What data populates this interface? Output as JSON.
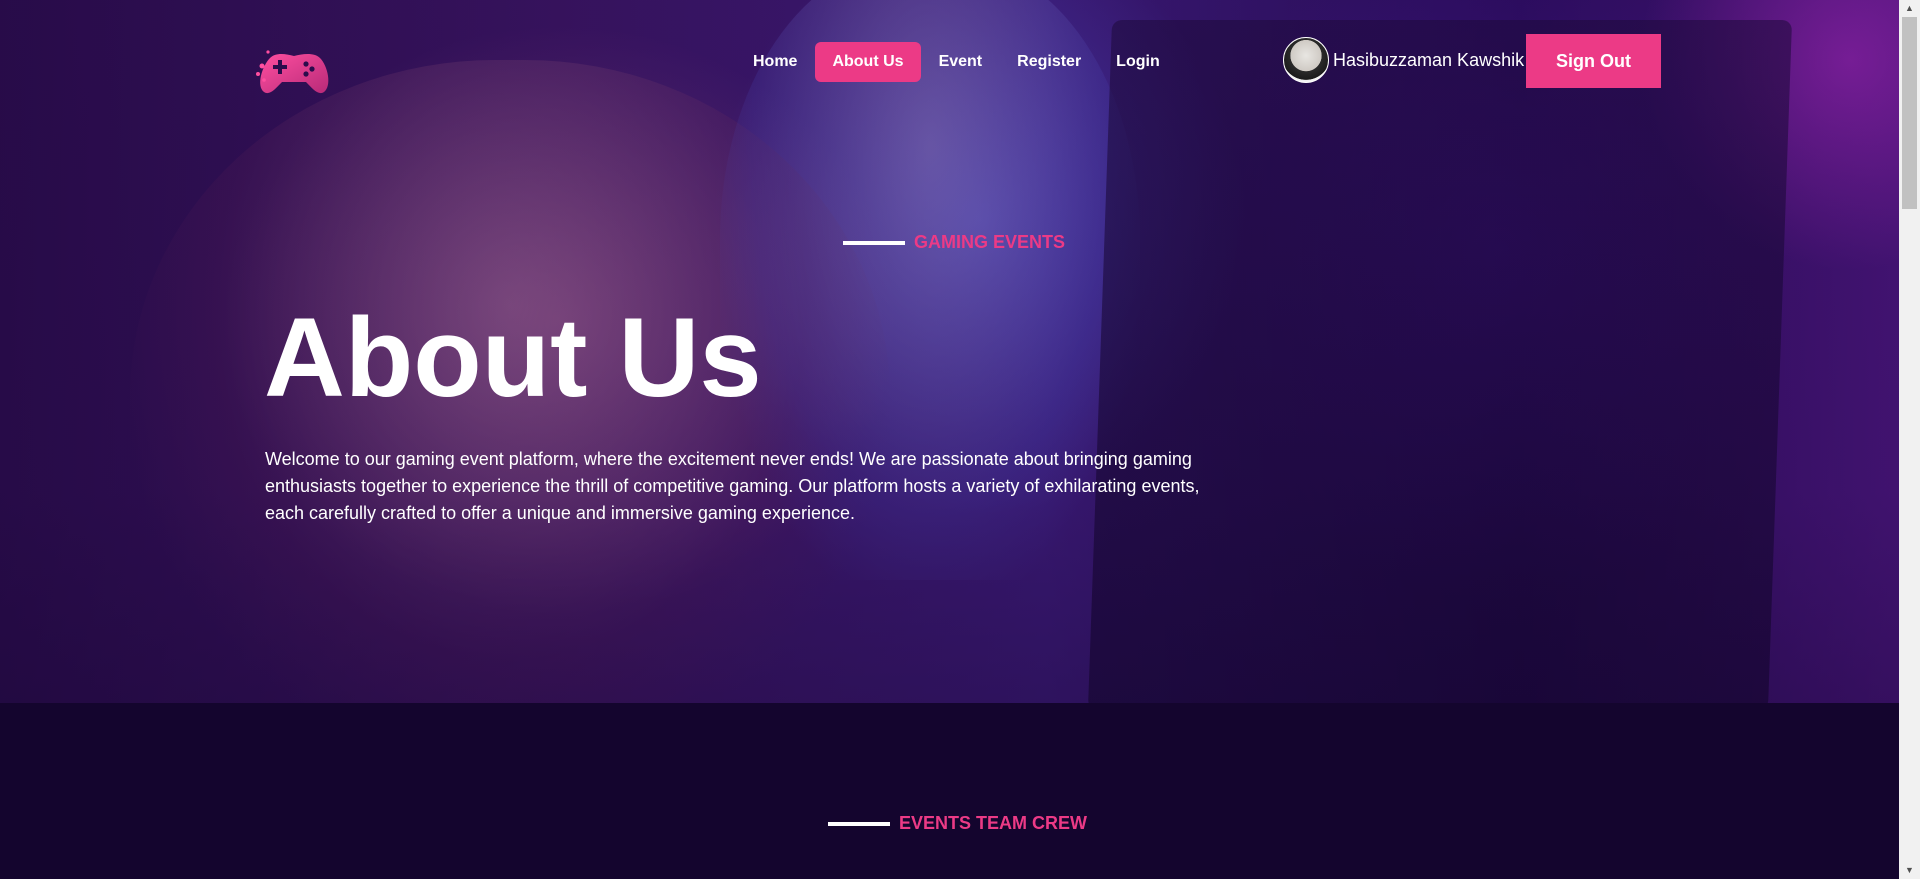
{
  "header": {
    "logo_icon": "gamepad-icon",
    "nav": [
      {
        "label": "Home"
      },
      {
        "label": "About Us",
        "active": true
      },
      {
        "label": "Event"
      },
      {
        "label": "Register"
      },
      {
        "label": "Login"
      }
    ],
    "user": {
      "name": "Hasibuzzaman Kawshik",
      "avatar_icon": "user-avatar"
    },
    "signout_label": "Sign Out"
  },
  "hero": {
    "eyebrow": "GAMING EVENTS",
    "title": "About Us",
    "description": "Welcome to our gaming event platform, where the excitement never ends! We are passionate about bringing gaming enthusiasts together to experience the thrill of competitive gaming. Our platform hosts a variety of exhilarating events, each carefully crafted to offer a unique and immersive gaming experience."
  },
  "team": {
    "eyebrow": "EVENTS TEAM CREW"
  },
  "colors": {
    "accent": "#ec3a86",
    "background": "#14052e",
    "text": "#ffffff"
  }
}
